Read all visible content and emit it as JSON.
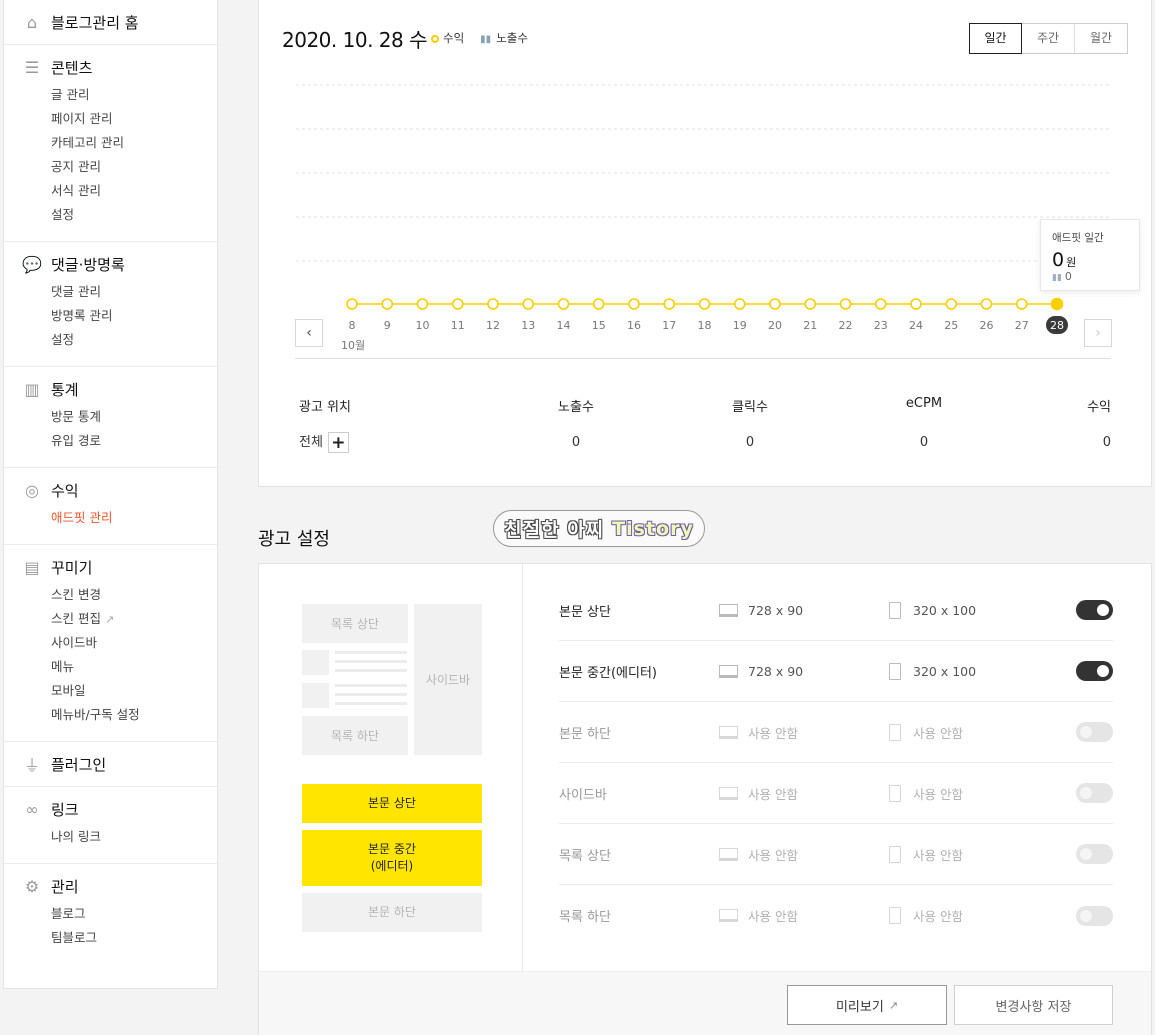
{
  "sidebar": {
    "groups": [
      {
        "icon": "home-icon",
        "title": "블로그관리 홈",
        "items": []
      },
      {
        "icon": "document-icon",
        "title": "콘텐츠",
        "items": [
          "글 관리",
          "페이지 관리",
          "카테고리 관리",
          "공지 관리",
          "서식 관리",
          "설정"
        ]
      },
      {
        "icon": "speech-bubble-icon",
        "title": "댓글·방명록",
        "items": [
          "댓글 관리",
          "방명록 관리",
          "설정"
        ]
      },
      {
        "icon": "bar-chart-icon",
        "title": "통계",
        "items": [
          "방문 통계",
          "유입 경로"
        ]
      },
      {
        "icon": "coins-icon",
        "title": "수익",
        "items": [
          "애드핏 관리"
        ],
        "active_item": "애드핏 관리"
      },
      {
        "icon": "layout-icon",
        "title": "꾸미기",
        "items": [
          "스킨 변경",
          "스킨 편집",
          "사이드바",
          "메뉴",
          "모바일",
          "메뉴바/구독 설정"
        ]
      },
      {
        "icon": "plug-icon",
        "title": "플러그인",
        "items": []
      },
      {
        "icon": "link-icon",
        "title": "링크",
        "items": [
          "나의 링크"
        ]
      },
      {
        "icon": "gear-icon",
        "title": "관리",
        "items": [
          "블로그",
          "팀블로그"
        ]
      }
    ]
  },
  "stats": {
    "date": "2020. 10. 28 수",
    "legend_revenue": "수익",
    "legend_impressions": "노출수",
    "period_tabs": [
      "일간",
      "주간",
      "월간"
    ],
    "active_period": "일간",
    "month_label": "10월",
    "tooltip": {
      "title": "애드핏 일간",
      "amount": "0",
      "unit": "원",
      "impressions": "0"
    },
    "table": {
      "headers": [
        "광고 위치",
        "노출수",
        "클릭수",
        "eCPM",
        "수익"
      ],
      "row": {
        "label": "전체",
        "impressions": "0",
        "clicks": "0",
        "ecpm": "0",
        "revenue": "0"
      }
    }
  },
  "chart_data": {
    "type": "line",
    "x": [
      "8",
      "9",
      "10",
      "11",
      "12",
      "13",
      "14",
      "15",
      "16",
      "17",
      "18",
      "19",
      "20",
      "21",
      "22",
      "23",
      "24",
      "25",
      "26",
      "27",
      "28"
    ],
    "series": [
      {
        "name": "수익",
        "values": [
          0,
          0,
          0,
          0,
          0,
          0,
          0,
          0,
          0,
          0,
          0,
          0,
          0,
          0,
          0,
          0,
          0,
          0,
          0,
          0,
          0
        ]
      }
    ],
    "selected_x": "28",
    "xlabel": "10월",
    "grid": true,
    "colors": {
      "line": "#f8cf00",
      "selected": "#3a3a3a"
    }
  },
  "watermark": {
    "text": "친절한 아찌",
    "brand": "Tistory"
  },
  "ad_settings": {
    "title": "광고 설정",
    "preview": {
      "list_top": "목록 상단",
      "sidebar": "사이드바",
      "list_bottom": "목록 하단",
      "buttons": [
        "본문 상단",
        "본문 중간\n(에디터)",
        "본문 하단"
      ]
    },
    "rows": [
      {
        "name": "본문 상단",
        "pc": "728 x 90",
        "mobile": "320 x 100",
        "on": true
      },
      {
        "name": "본문 중간(에디터)",
        "pc": "728 x 90",
        "mobile": "320 x 100",
        "on": true
      },
      {
        "name": "본문 하단",
        "pc": "사용 안함",
        "mobile": "사용 안함",
        "on": false
      },
      {
        "name": "사이드바",
        "pc": "사용 안함",
        "mobile": "사용 안함",
        "on": false
      },
      {
        "name": "목록 상단",
        "pc": "사용 안함",
        "mobile": "사용 안함",
        "on": false
      },
      {
        "name": "목록 하단",
        "pc": "사용 안함",
        "mobile": "사용 안함",
        "on": false
      }
    ],
    "preview_button": "미리보기",
    "save_button": "변경사항 저장"
  }
}
